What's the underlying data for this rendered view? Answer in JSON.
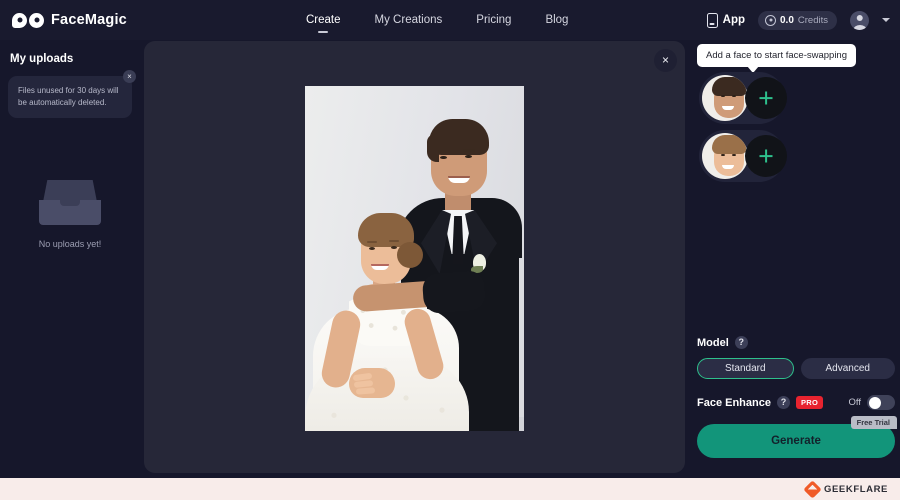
{
  "header": {
    "brand": "FaceMagic",
    "logo_icon": "facemagic-eyes-logo",
    "nav": [
      {
        "label": "Create",
        "active": true
      },
      {
        "label": "My Creations",
        "active": false
      },
      {
        "label": "Pricing",
        "active": false
      },
      {
        "label": "Blog",
        "active": false
      }
    ],
    "app_link": {
      "label": "App",
      "icon": "phone-icon"
    },
    "credits": {
      "value": "0.0",
      "label": "Credits",
      "icon": "coin-icon"
    },
    "avatar_icon": "user-avatar",
    "chevron_icon": "chevron-down-icon"
  },
  "sidebar": {
    "title": "My uploads",
    "notice": {
      "text": "Files unused for 30 days will be automatically deleted.",
      "close_label": "×"
    },
    "empty_state": {
      "icon": "tray-icon",
      "text": "No uploads yet!"
    }
  },
  "canvas": {
    "close_label": "×",
    "image_alt": "Wedding couple photo - bride in white lace gown and groom in black suit"
  },
  "right_panel": {
    "tooltip": "Add a face to start face-swapping",
    "face_slots": [
      {
        "face": "groom-face",
        "add_label": "+"
      },
      {
        "face": "bride-face",
        "add_label": "+"
      }
    ],
    "model": {
      "label": "Model",
      "help_label": "?",
      "options": [
        {
          "label": "Standard",
          "selected": true
        },
        {
          "label": "Advanced",
          "selected": false
        }
      ]
    },
    "face_enhance": {
      "label": "Face Enhance",
      "help_label": "?",
      "badge": "PRO",
      "state_label": "Off",
      "enabled": false
    },
    "generate": {
      "label": "Generate",
      "ribbon": "Free Trial"
    }
  },
  "footer": {
    "watermark": "GEEKFLARE",
    "logo_icon": "geekflare-logo"
  },
  "colors": {
    "page_bg": "#16172b",
    "header_bg": "#191a2e",
    "canvas_bg": "#262738",
    "accent_green": "#2ec08c",
    "generate_bg": "#12957a",
    "pro_red": "#e8232f",
    "footer_bg": "#f8ecea",
    "geekflare_orange": "#f05a28"
  }
}
